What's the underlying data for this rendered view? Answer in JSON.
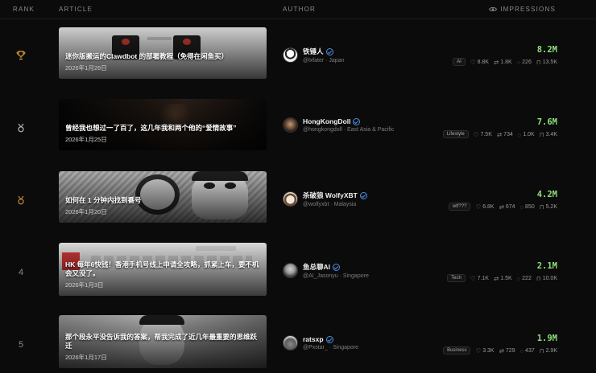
{
  "headers": {
    "rank": "RANK",
    "article": "ARTICLE",
    "author": "AUTHOR",
    "impressions": "IMPRESSIONS"
  },
  "rows": [
    {
      "rank": "",
      "rank_icon": "trophy-icon",
      "title": "迷你版搬运的Clawdbot 的部署教程（免得在闲鱼买）",
      "date": "2026年1月26日",
      "author_name": "铁锤人",
      "author_handle": "@lxfater",
      "author_location": "Japan",
      "impressions": "8.2M",
      "tag": "AI",
      "likes": "8.8K",
      "reposts": "1.8K",
      "replies": "226",
      "bookmarks": "13.5K"
    },
    {
      "rank": "",
      "rank_icon": "medal-silver-icon",
      "title": "曾经我也想过一了百了，这几年我和两个他的“爱情故事”",
      "date": "2026年1月25日",
      "author_name": "HongKongDoll",
      "author_handle": "@hongkongdoll",
      "author_location": "East Asia & Pacific",
      "impressions": "7.6M",
      "tag": "Lifestyle",
      "likes": "7.5K",
      "reposts": "734",
      "replies": "1.0K",
      "bookmarks": "3.4K"
    },
    {
      "rank": "",
      "rank_icon": "medal-bronze-icon",
      "title": "如何在 1 分钟内找到番号",
      "date": "2026年1月20日",
      "author_name": "杀破狼 WolfyXBT",
      "author_handle": "@wolfyxbt",
      "author_location": "Malaysia",
      "impressions": "4.2M",
      "tag": "wtf???",
      "likes": "6.8K",
      "reposts": "674",
      "replies": "850",
      "bookmarks": "5.2K"
    },
    {
      "rank": "4",
      "rank_icon": "",
      "title": "HK 每年6快钱！香港手机号线上申请全攻略，抓紧上车，要不机会又没了。",
      "date": "2026年1月3日",
      "author_name": "鱼总聊AI",
      "author_handle": "@AI_Jasonyu",
      "author_location": "Singapore",
      "impressions": "2.1M",
      "tag": "Tech",
      "likes": "7.1K",
      "reposts": "1.5K",
      "replies": "222",
      "bookmarks": "10.0K"
    },
    {
      "rank": "5",
      "rank_icon": "",
      "title": "那个段永平没告诉我的答案，帮我完成了近几年最重要的思维跃迁",
      "date": "2026年1月17日",
      "author_name": "ratsxp",
      "author_handle": "@Pxstar_",
      "author_location": "Singapore",
      "impressions": "1.9M",
      "tag": "Business",
      "likes": "3.3K",
      "reposts": "729",
      "replies": "437",
      "bookmarks": "2.9K"
    }
  ],
  "colors": {
    "accent_green": "#8ee07a",
    "verified_blue": "#4a90e2",
    "gold": "#d9a23a",
    "silver": "#b8b8b8",
    "bronze": "#c98a3a"
  }
}
